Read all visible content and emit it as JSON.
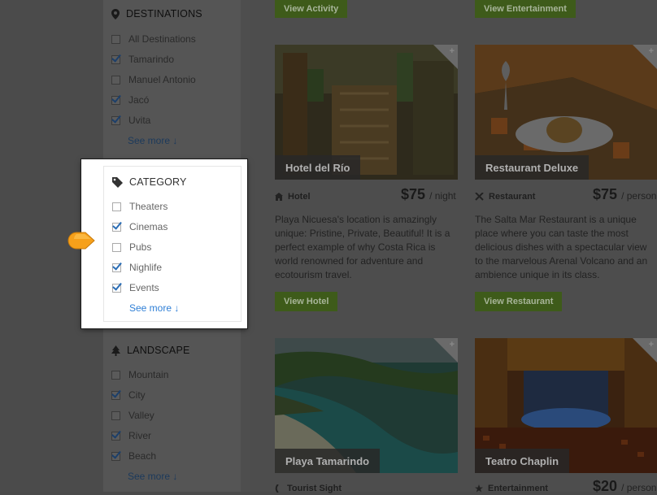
{
  "sidebar": {
    "destinations": {
      "title": "DESTINATIONS",
      "items": [
        {
          "label": "All Destinations",
          "checked": false
        },
        {
          "label": "Tamarindo",
          "checked": true
        },
        {
          "label": "Manuel Antonio",
          "checked": false
        },
        {
          "label": "Jacó",
          "checked": true
        },
        {
          "label": "Uvita",
          "checked": true
        }
      ],
      "see_more": "See more ↓"
    },
    "category": {
      "title": "CATEGORY",
      "items": [
        {
          "label": "Theaters",
          "checked": false
        },
        {
          "label": "Cinemas",
          "checked": true
        },
        {
          "label": "Pubs",
          "checked": false
        },
        {
          "label": "Nighlife",
          "checked": true
        },
        {
          "label": "Events",
          "checked": true
        }
      ],
      "see_more": "See more ↓"
    },
    "landscape": {
      "title": "LANDSCAPE",
      "items": [
        {
          "label": "Mountain",
          "checked": false
        },
        {
          "label": "City",
          "checked": true
        },
        {
          "label": "Valley",
          "checked": false
        },
        {
          "label": "River",
          "checked": true
        },
        {
          "label": "Beach",
          "checked": true
        }
      ],
      "see_more": "See more ↓"
    }
  },
  "top_buttons": {
    "left": "View Activity",
    "right": "View Entertainment"
  },
  "cards": [
    {
      "title": "Hotel del Río",
      "type": "Hotel",
      "price": "$75",
      "unit": "/ night",
      "description": "Playa Nicuesa's location is amazingly unique: Pristine, Private, Beautiful! It is a perfect example of why Costa Rica is world renowned for adventure and ecotourism travel.",
      "button": "View Hotel"
    },
    {
      "title": "Restaurant Deluxe",
      "type": "Restaurant",
      "price": "$75",
      "unit": "/ person",
      "description": "The Salta Mar Restaurant is a unique place where you can taste the most delicious dishes with a spectacular view to the marvelous Arenal Volcano and an ambience unique in its class.",
      "button": "View Restaurant"
    },
    {
      "title": "Playa Tamarindo",
      "type": "Tourist Sight"
    },
    {
      "title": "Teatro Chaplin",
      "type": "Entertainment",
      "price": "$20",
      "unit": "/ person"
    }
  ],
  "colors": {
    "accent_green": "#6aa32c",
    "link_blue": "#2f7fd6",
    "pointer_orange": "#f6a01a"
  }
}
